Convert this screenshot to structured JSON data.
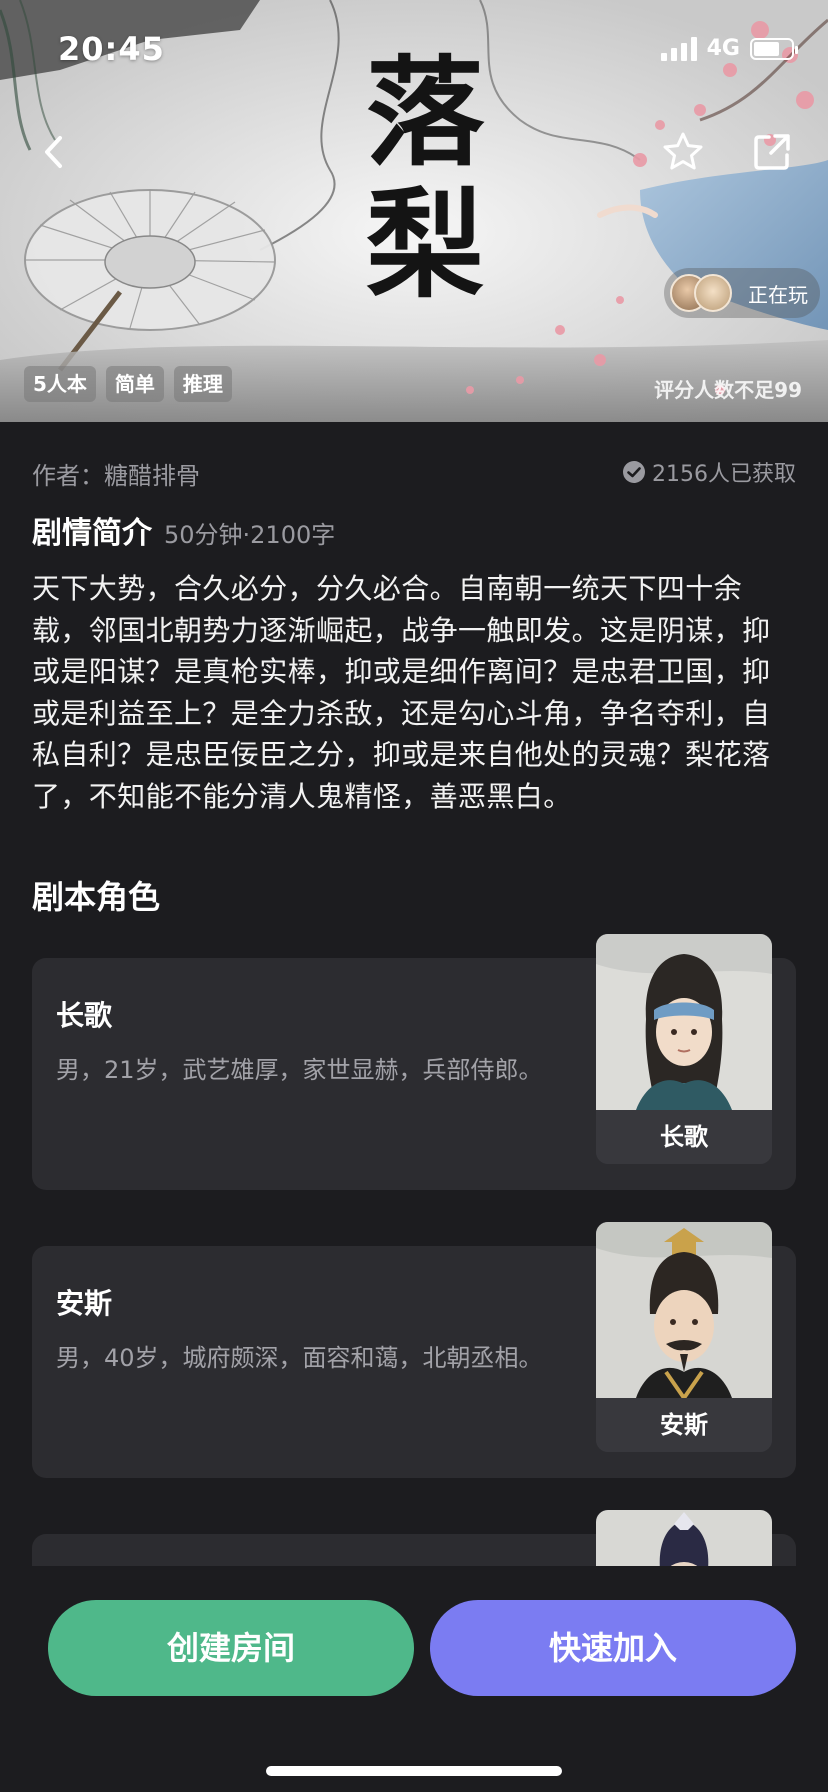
{
  "status_bar": {
    "time": "20:45",
    "network": "4G"
  },
  "hero": {
    "title_calligraphy": "落梨",
    "playing_label": "正在玩",
    "tags": [
      "5人本",
      "简单",
      "推理"
    ],
    "rating_note": "评分人数不足99"
  },
  "info": {
    "author": "作者：糖醋排骨",
    "obtained": "2156人已获取",
    "synopsis_title": "剧情简介",
    "synopsis_meta": "50分钟·2100字",
    "synopsis_text": "天下大势，合久必分，分久必合。自南朝一统天下四十余载，邻国北朝势力逐渐崛起，战争一触即发。这是阴谋，抑或是阳谋？是真枪实棒，抑或是细作离间？是忠君卫国，抑或是利益至上？是全力杀敌，还是勾心斗角，争名夺利，自私自利？是忠臣佞臣之分，抑或是来自他处的灵魂？梨花落了，不知能不能分清人鬼精怪，善恶黑白。"
  },
  "roles": {
    "title": "剧本角色",
    "items": [
      {
        "name": "长歌",
        "desc": "男，21岁，武艺雄厚，家世显赫，兵部侍郎。",
        "portrait_label": "长歌"
      },
      {
        "name": "安斯",
        "desc": "男，40岁，城府颇深，面容和蔼，北朝丞相。",
        "portrait_label": "安斯"
      }
    ]
  },
  "actions": {
    "create_room": "创建房间",
    "quick_join": "快速加入"
  },
  "colors": {
    "background": "#1c1c1f",
    "card": "#2c2c30",
    "create_button": "#4fb88a",
    "join_button": "#7b7cf2"
  }
}
